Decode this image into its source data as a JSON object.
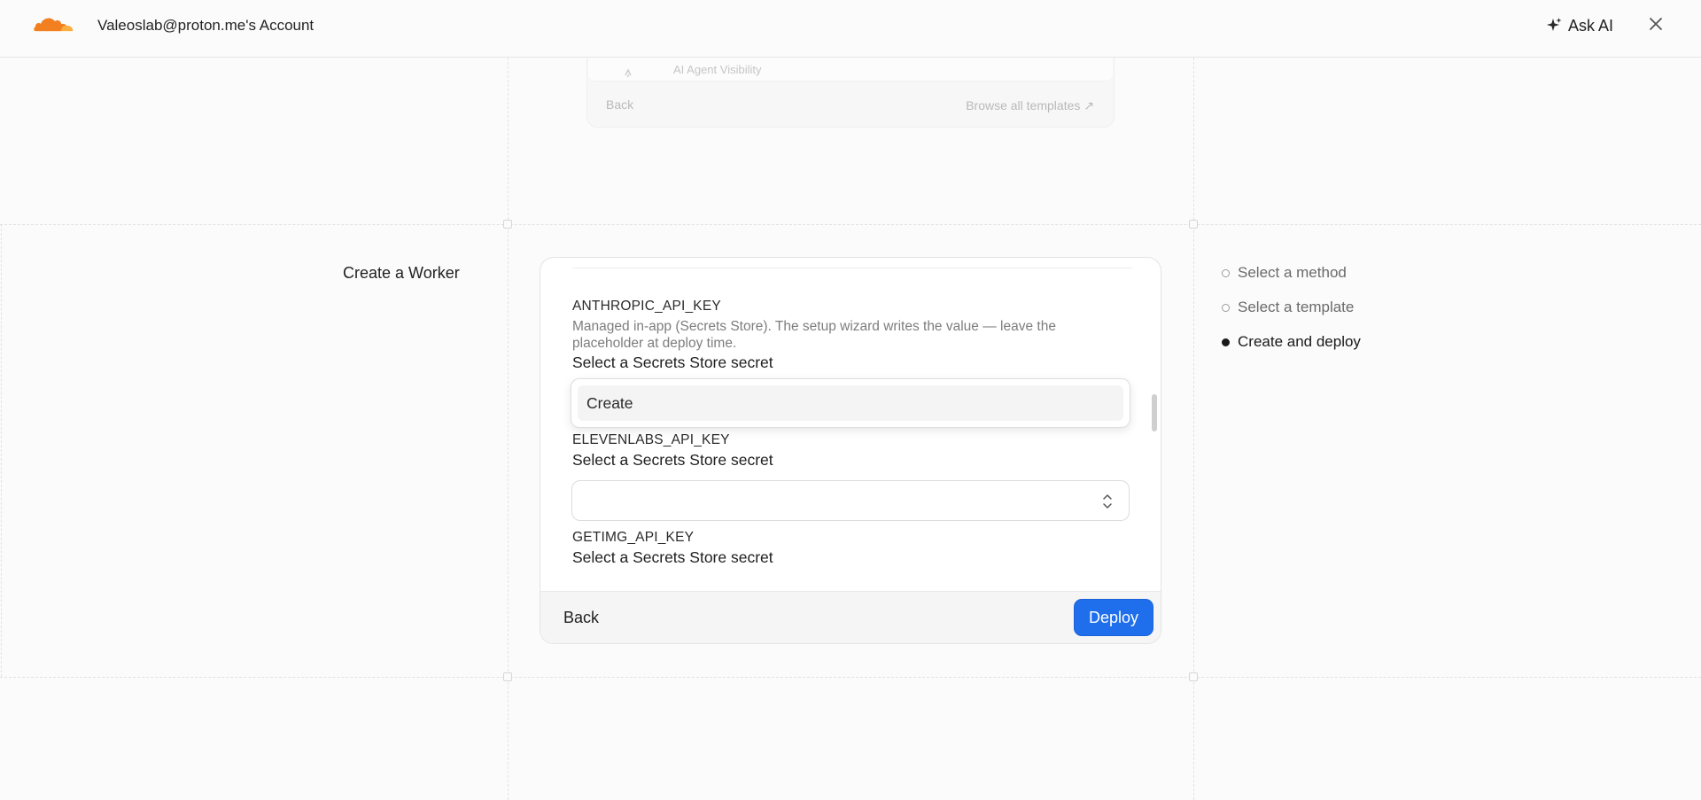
{
  "header": {
    "account_title": "Valeoslab@proton.me's Account",
    "ask_ai_label": "Ask AI",
    "brand_color": "#f38020"
  },
  "previous_card": {
    "item_label": "AI Agent Visibility",
    "back_label": "Back",
    "browse_label": "Browse all templates ↗"
  },
  "section": {
    "title": "Create a Worker"
  },
  "form": {
    "secrets": [
      {
        "key": "ANTHROPIC_API_KEY",
        "description": "Managed in-app (Secrets Store). The setup wizard writes the value — leave the placeholder at deploy time.",
        "select_label": "Select a Secrets Store secret",
        "value": ""
      },
      {
        "key": "ELEVENLABS_API_KEY",
        "select_label": "Select a Secrets Store secret",
        "value": ""
      },
      {
        "key": "GETIMG_API_KEY",
        "select_label": "Select a Secrets Store secret"
      }
    ],
    "dropdown_options": [
      "Create"
    ]
  },
  "footer": {
    "back_label": "Back",
    "deploy_label": "Deploy",
    "deploy_color": "#1f6fed"
  },
  "steps": [
    {
      "label": "Select a method",
      "state": "done"
    },
    {
      "label": "Select a template",
      "state": "done"
    },
    {
      "label": "Create and deploy",
      "state": "active"
    }
  ]
}
